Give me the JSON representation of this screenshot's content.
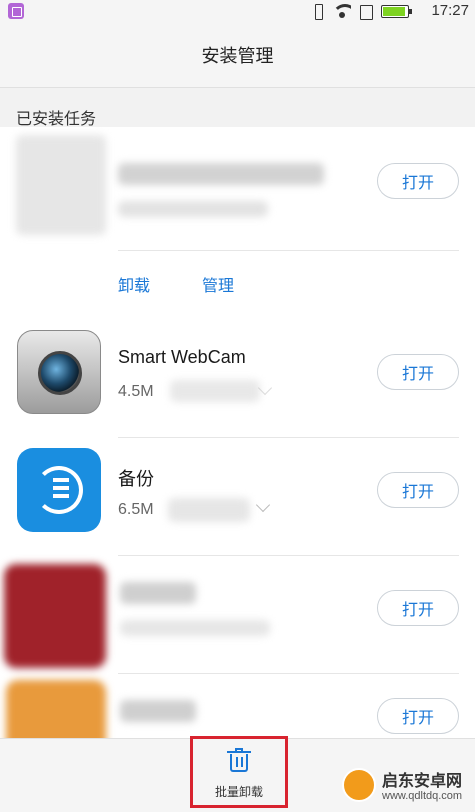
{
  "status_bar": {
    "time": "17:27"
  },
  "header": {
    "title": "安装管理"
  },
  "section": {
    "title": "已安装任务"
  },
  "apps": [
    {
      "name": "",
      "size": "",
      "open_label": "打开",
      "expanded": true,
      "actions": {
        "uninstall": "卸载",
        "manage": "管理"
      }
    },
    {
      "name": "Smart WebCam",
      "size": "4.5M",
      "open_label": "打开"
    },
    {
      "name": "备份",
      "size": "6.5M",
      "open_label": "打开"
    },
    {
      "name": "",
      "size": "",
      "open_label": "打开"
    },
    {
      "name": "",
      "size": "",
      "open_label": "打开"
    }
  ],
  "bottom_bar": {
    "batch_uninstall_label": "批量卸载"
  },
  "watermark": {
    "name": "启东安卓网",
    "url": "www.qdltdq.com"
  },
  "colors": {
    "accent": "#1a77d6",
    "highlight_box": "#d8232f",
    "backup_icon": "#1a8ee0"
  }
}
